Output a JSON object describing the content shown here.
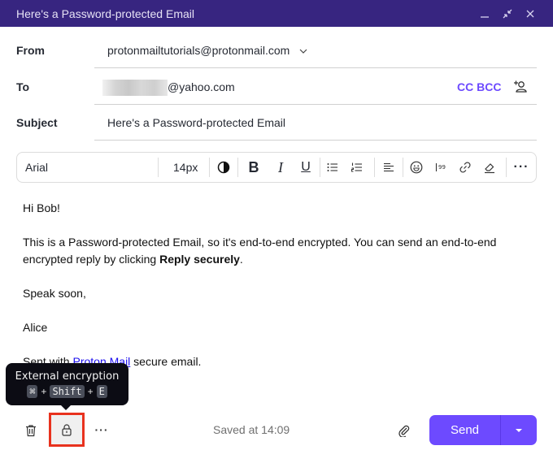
{
  "window": {
    "title": "Here's a Password-protected Email",
    "controls": {
      "minimize": "minimize-icon",
      "collapse": "collapse-icon",
      "close": "close-icon"
    }
  },
  "fields": {
    "from_label": "From",
    "from_value": "protonmailtutorials@protonmail.com",
    "to_label": "To",
    "to_value": "@yahoo.com",
    "cc_bcc": "CC BCC",
    "subject_label": "Subject",
    "subject_value": "Here's a Password-protected Email"
  },
  "toolbar": {
    "font": "Arial",
    "size": "14px",
    "icons": [
      "contrast-icon",
      "bold-icon",
      "italic-icon",
      "underline-icon",
      "bullet-list-icon",
      "numbered-list-icon",
      "align-left-icon",
      "emoji-icon",
      "quote-icon",
      "link-icon",
      "eraser-icon",
      "more-icon"
    ]
  },
  "body": {
    "greeting": "Hi Bob!",
    "para1_pre": "This is a Password-protected Email, so it's end-to-end encrypted. You can send an end-to-end encrypted reply by clicking ",
    "para1_bold": "Reply securely",
    "para1_post": ".",
    "closing": "Speak soon,",
    "signature": "Alice",
    "footer_pre": "Sent with ",
    "footer_link": "Proton Mail",
    "footer_post": " secure email."
  },
  "tooltip": {
    "title": "External encryption",
    "key1": "⌘",
    "plus": "+",
    "key2": "Shift",
    "key3": "E"
  },
  "footer": {
    "saved": "Saved at 14:09",
    "send": "Send",
    "accent": "#6d4aff"
  }
}
